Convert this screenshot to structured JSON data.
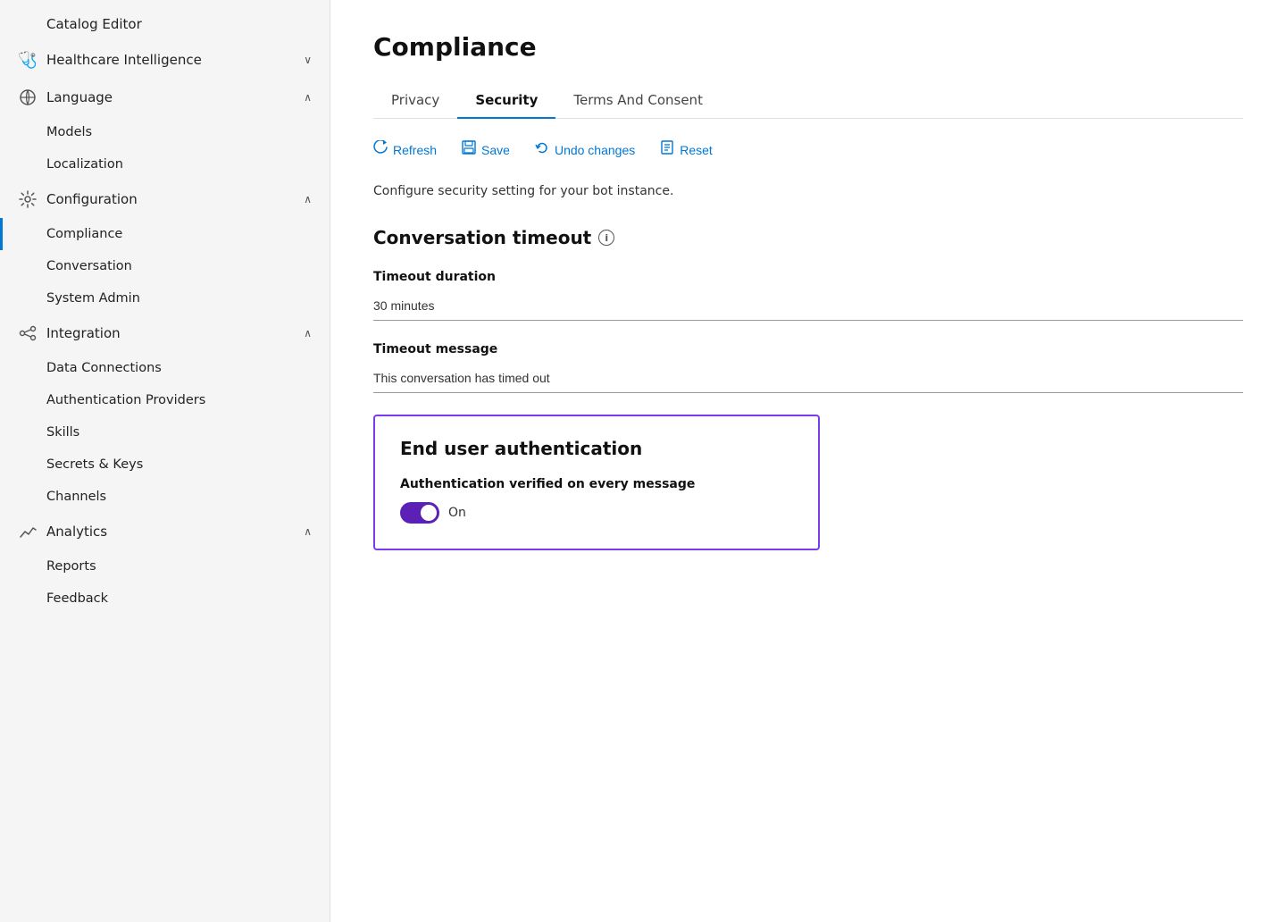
{
  "sidebar": {
    "catalog_item": "Catalog Editor",
    "items": [
      {
        "id": "healthcare-intelligence",
        "label": "Healthcare Intelligence",
        "icon": "🩺",
        "expanded": true,
        "level": "section"
      },
      {
        "id": "language",
        "label": "Language",
        "icon": "⚙",
        "expanded": true,
        "level": "section"
      },
      {
        "id": "models",
        "label": "Models",
        "level": "sub"
      },
      {
        "id": "localization",
        "label": "Localization",
        "level": "sub"
      },
      {
        "id": "configuration",
        "label": "Configuration",
        "icon": "⚙",
        "expanded": true,
        "level": "section"
      },
      {
        "id": "compliance",
        "label": "Compliance",
        "level": "sub",
        "active": true
      },
      {
        "id": "conversation",
        "label": "Conversation",
        "level": "sub"
      },
      {
        "id": "system-admin",
        "label": "System Admin",
        "level": "sub"
      },
      {
        "id": "integration",
        "label": "Integration",
        "icon": "🔗",
        "expanded": true,
        "level": "section"
      },
      {
        "id": "data-connections",
        "label": "Data Connections",
        "level": "sub"
      },
      {
        "id": "auth-providers",
        "label": "Authentication Providers",
        "level": "sub"
      },
      {
        "id": "skills",
        "label": "Skills",
        "level": "sub"
      },
      {
        "id": "secrets-keys",
        "label": "Secrets & Keys",
        "level": "sub"
      },
      {
        "id": "channels",
        "label": "Channels",
        "level": "sub"
      },
      {
        "id": "analytics",
        "label": "Analytics",
        "icon": "📊",
        "expanded": true,
        "level": "section"
      },
      {
        "id": "reports",
        "label": "Reports",
        "level": "sub"
      },
      {
        "id": "feedback",
        "label": "Feedback",
        "level": "sub"
      }
    ]
  },
  "main": {
    "page_title": "Compliance",
    "tabs": [
      {
        "id": "privacy",
        "label": "Privacy",
        "active": false
      },
      {
        "id": "security",
        "label": "Security",
        "active": true
      },
      {
        "id": "terms",
        "label": "Terms And Consent",
        "active": false
      }
    ],
    "toolbar": {
      "refresh": "Refresh",
      "save": "Save",
      "undo": "Undo changes",
      "reset": "Reset"
    },
    "description": "Configure security setting for your bot instance.",
    "conversation_timeout": {
      "title": "Conversation timeout",
      "timeout_duration_label": "Timeout duration",
      "timeout_duration_value": "30 minutes",
      "timeout_message_label": "Timeout message",
      "timeout_message_value": "This conversation has timed out"
    },
    "end_user_auth": {
      "title": "End user authentication",
      "toggle_label": "Authentication verified on every message",
      "toggle_state": "On",
      "toggle_on": true
    }
  }
}
